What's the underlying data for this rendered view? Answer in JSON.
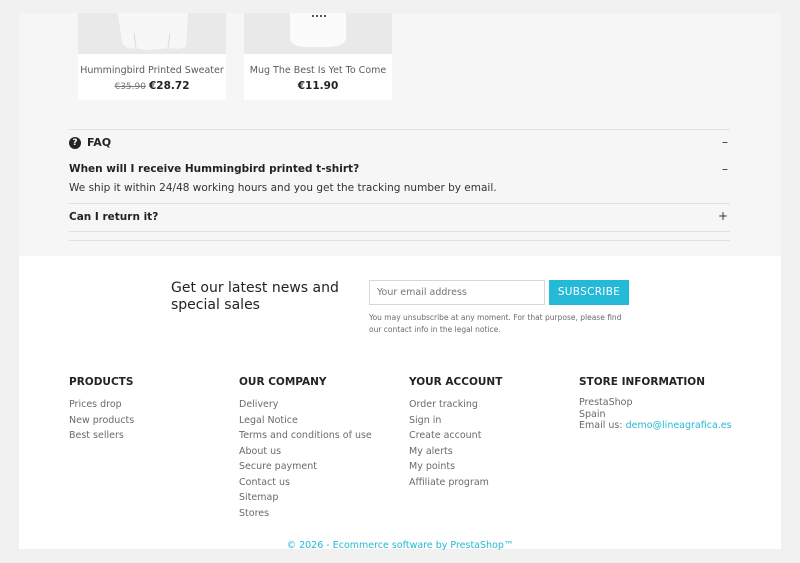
{
  "products": [
    {
      "name": "Hummingbird Printed Sweater",
      "old_price": "€35.90",
      "price": "€28.72"
    },
    {
      "name": "Mug The Best Is Yet To Come",
      "old_price": "",
      "price": "€11.90"
    }
  ],
  "faq": {
    "title": "FAQ",
    "title_toggle": "–",
    "items": [
      {
        "question": "When will I receive Hummingbird printed t-shirt?",
        "toggle": "–",
        "answer": "We ship it within 24/48 working hours and you get the tracking number by email."
      },
      {
        "question": "Can I return it?",
        "toggle": "+"
      }
    ]
  },
  "newsletter": {
    "title": "Get our latest news and special sales",
    "placeholder": "Your email address",
    "button": "SUBSCRIBE",
    "note": "You may unsubscribe at any moment. For that purpose, please find our contact info in the legal notice."
  },
  "footer": {
    "products": {
      "title": "PRODUCTS",
      "links": [
        "Prices drop",
        "New products",
        "Best sellers"
      ]
    },
    "company": {
      "title": "OUR COMPANY",
      "links": [
        "Delivery",
        "Legal Notice",
        "Terms and conditions of use",
        "About us",
        "Secure payment",
        "Contact us",
        "Sitemap",
        "Stores"
      ]
    },
    "account": {
      "title": "YOUR ACCOUNT",
      "links": [
        "Order tracking",
        "Sign in",
        "Create account",
        "My alerts",
        "My points",
        "Affiliate program"
      ]
    },
    "store": {
      "title": "STORE INFORMATION",
      "name": "PrestaShop",
      "country": "Spain",
      "email_label": "Email us:",
      "email": "demo@lineagrafica.es"
    },
    "copyright": "© 2026 - Ecommerce software by PrestaShop™"
  },
  "colors": {
    "accent": "#24b9d7"
  }
}
